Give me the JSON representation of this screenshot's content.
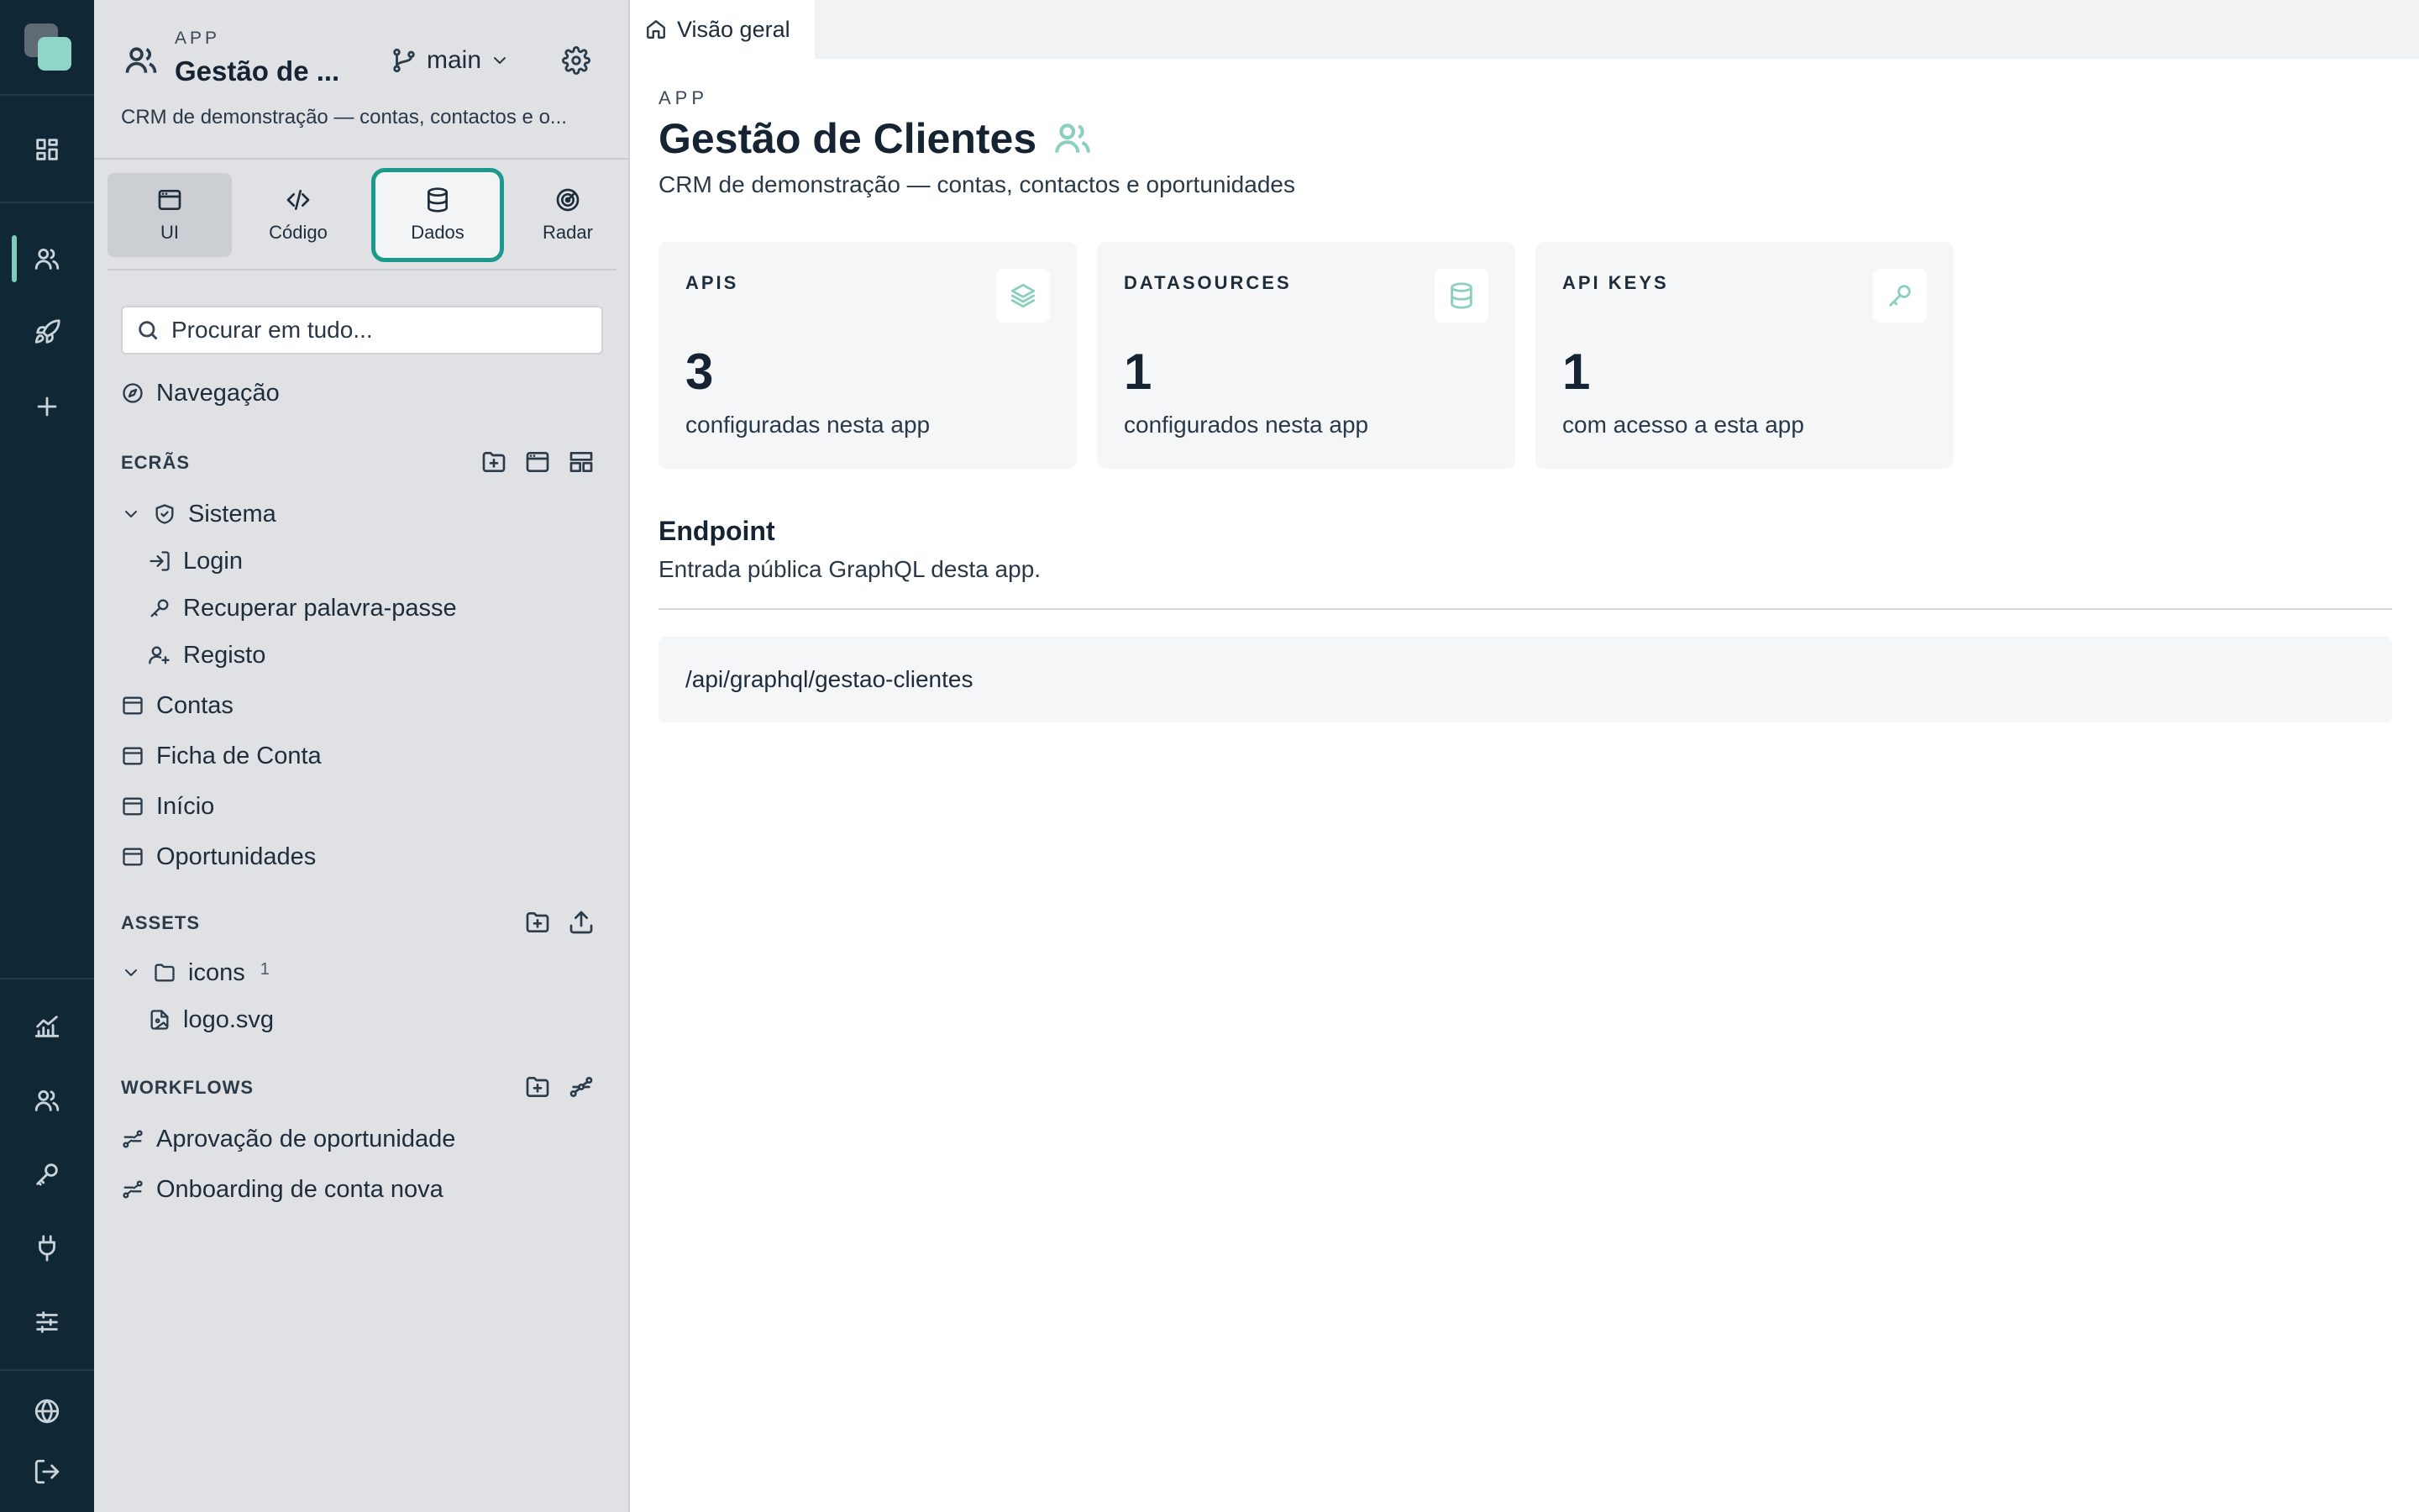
{
  "rail": {
    "items": [
      {
        "icon": "dashboard-icon"
      },
      {
        "icon": "users-icon",
        "active": true
      },
      {
        "icon": "rocket-icon"
      },
      {
        "icon": "plus-icon"
      },
      {
        "icon": "analytics-icon"
      },
      {
        "icon": "team-icon"
      },
      {
        "icon": "key-icon"
      },
      {
        "icon": "plug-icon"
      },
      {
        "icon": "sliders-icon"
      },
      {
        "icon": "globe-icon"
      },
      {
        "icon": "logout-icon"
      }
    ]
  },
  "sidebar": {
    "overline": "APP",
    "title": "Gestão de ...",
    "branch": "main",
    "description": "CRM de demonstração — contas, contactos e o...",
    "tabs": {
      "ui": "UI",
      "codigo": "Código",
      "dados": "Dados",
      "radar": "Radar"
    },
    "search_placeholder": "Procurar em tudo...",
    "navigation": "Navegação",
    "screens": {
      "label": "ECRÃS",
      "group": "Sistema",
      "children": [
        "Login",
        "Recuperar palavra-passe",
        "Registo"
      ],
      "items": [
        "Contas",
        "Ficha de Conta",
        "Início",
        "Oportunidades"
      ]
    },
    "assets": {
      "label": "ASSETS",
      "folder": "icons",
      "folder_count": "1",
      "file": "logo.svg"
    },
    "workflows": {
      "label": "WORKFLOWS",
      "items": [
        "Aprovação de oportunidade",
        "Onboarding de conta nova"
      ]
    }
  },
  "main": {
    "tab": "Visão geral",
    "overline": "APP",
    "title": "Gestão de Clientes",
    "description": "CRM de demonstração — contas, contactos e oportunidades",
    "cards": [
      {
        "label": "APIS",
        "value": "3",
        "sub": "configuradas nesta app",
        "icon": "layers-icon"
      },
      {
        "label": "DATASOURCES",
        "value": "1",
        "sub": "configurados nesta app",
        "icon": "database-icon"
      },
      {
        "label": "API KEYS",
        "value": "1",
        "sub": "com acesso a esta app",
        "icon": "key-icon"
      }
    ],
    "endpoint": {
      "title": "Endpoint",
      "description": "Entrada pública GraphQL desta app.",
      "url": "/api/graphql/gestao-clientes"
    }
  },
  "colors": {
    "rail_bg": "#102735",
    "accent": "#1a9a8a",
    "accent_light": "#8ccfc1",
    "sidebar_bg": "#dfe1e4"
  }
}
